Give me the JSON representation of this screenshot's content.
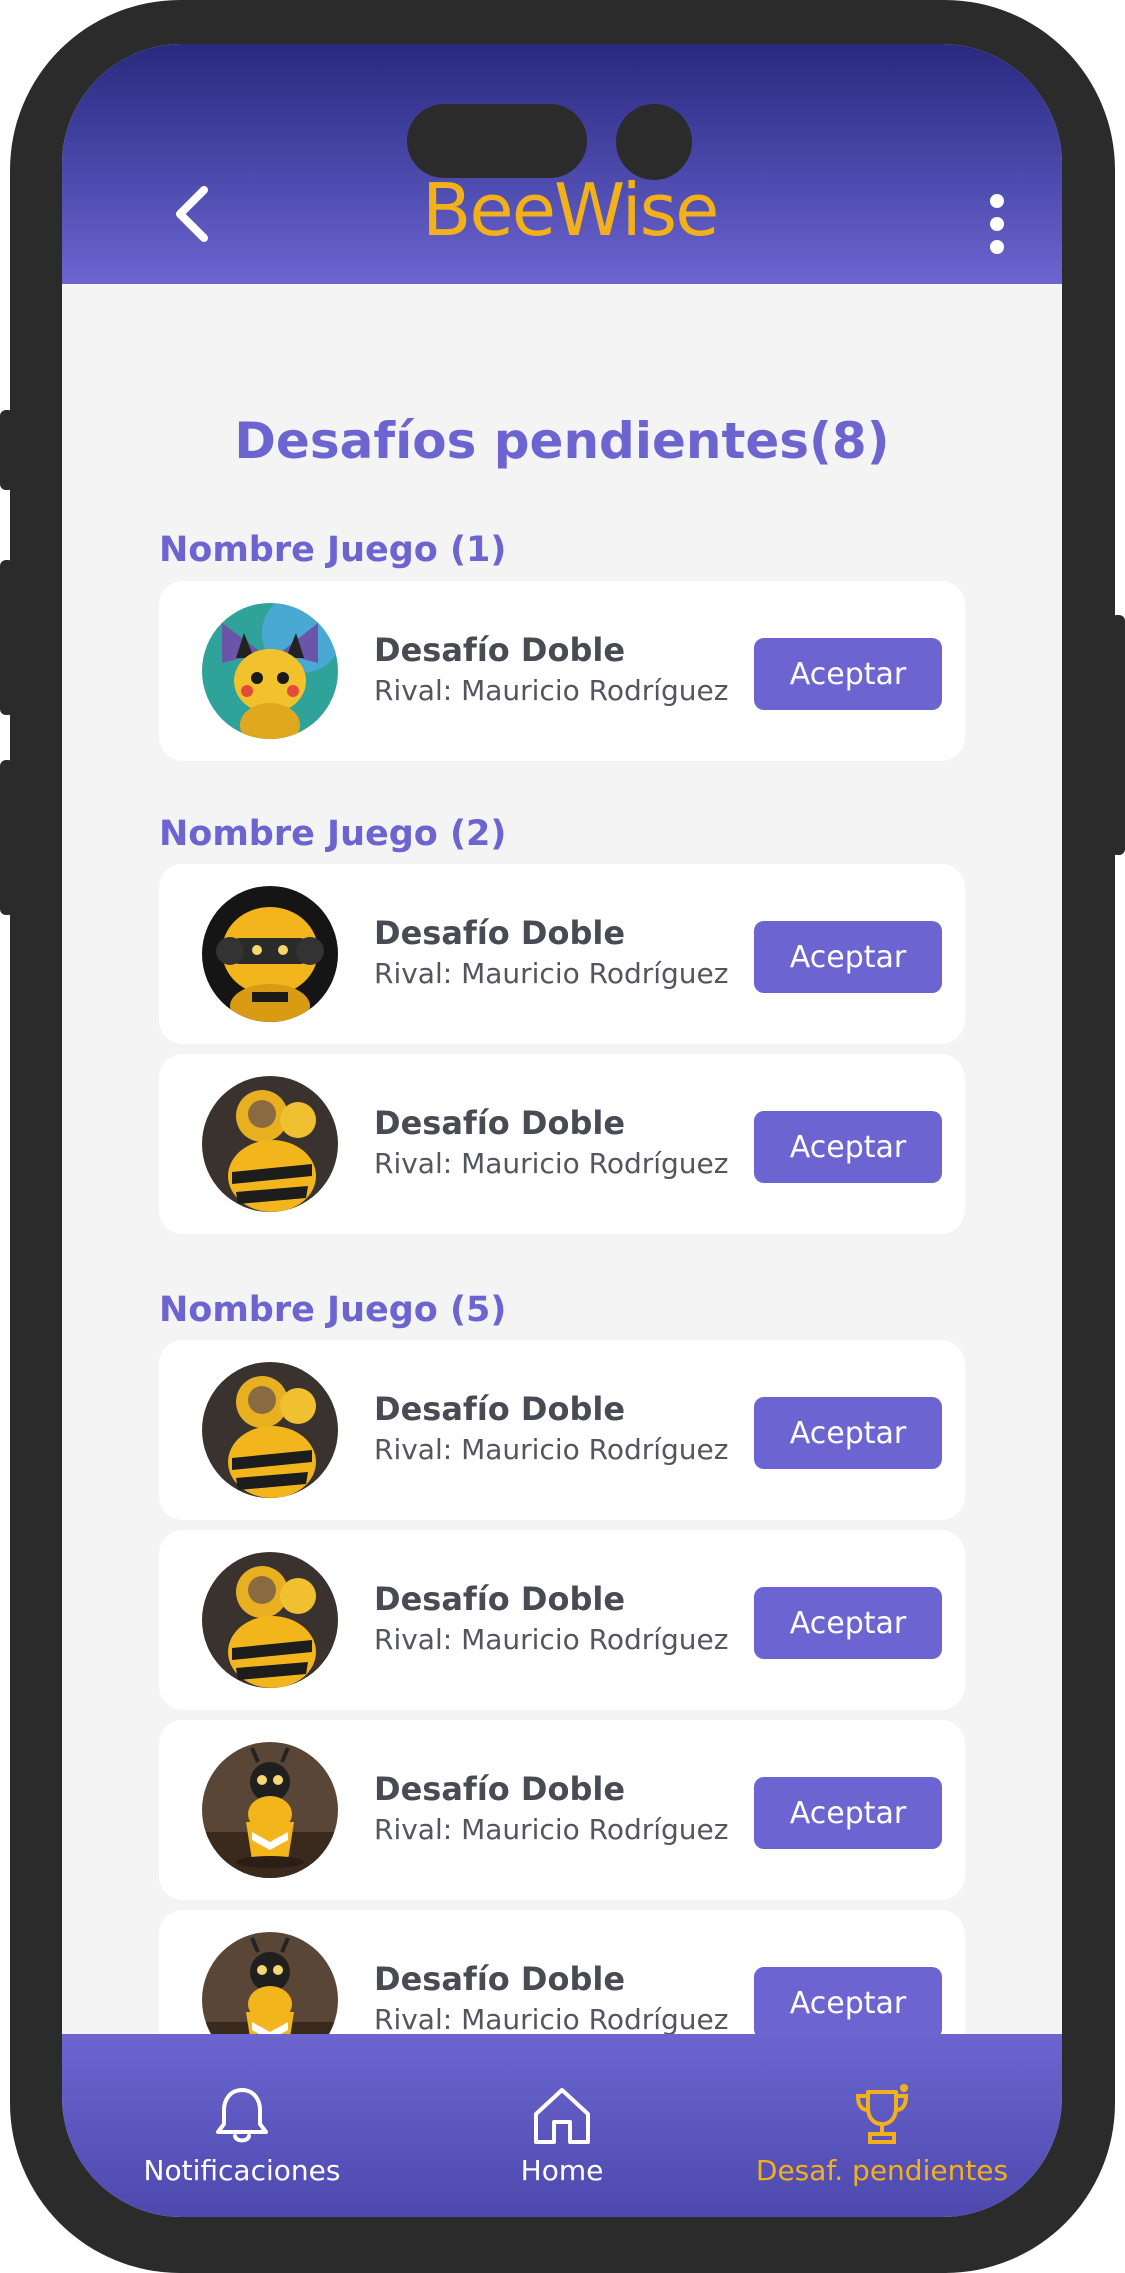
{
  "app": {
    "logo": "BeeWise"
  },
  "page": {
    "title": "Desafíos pendientes(8)"
  },
  "groups": [
    {
      "title": "Nombre Juego (1)"
    },
    {
      "title": "Nombre Juego (2)"
    },
    {
      "title": "Nombre Juego (5)"
    }
  ],
  "cards": [
    {
      "title": "Desafío Doble",
      "rival": "Rival: Mauricio Rodríguez",
      "button": "Aceptar",
      "avatar_icon": "pikachu-bee-avatar"
    },
    {
      "title": "Desafío Doble",
      "rival": "Rival: Mauricio Rodríguez",
      "button": "Aceptar",
      "avatar_icon": "robot-bee-avatar"
    },
    {
      "title": "Desafío Doble",
      "rival": "Rival: Mauricio Rodríguez",
      "button": "Aceptar",
      "avatar_icon": "armored-bee-avatar"
    },
    {
      "title": "Desafío Doble",
      "rival": "Rival: Mauricio Rodríguez",
      "button": "Aceptar",
      "avatar_icon": "armored-bee-avatar"
    },
    {
      "title": "Desafío Doble",
      "rival": "Rival: Mauricio Rodríguez",
      "button": "Aceptar",
      "avatar_icon": "armored-bee-avatar"
    },
    {
      "title": "Desafío Doble",
      "rival": "Rival: Mauricio Rodríguez",
      "button": "Aceptar",
      "avatar_icon": "cup-bee-avatar"
    },
    {
      "title": "Desafío Doble",
      "rival": "Rival: Mauricio Rodríguez",
      "button": "Aceptar",
      "avatar_icon": "cup-bee-avatar"
    }
  ],
  "nav": {
    "items": [
      {
        "label": "Notificaciones",
        "icon": "bell-icon"
      },
      {
        "label": "Home",
        "icon": "home-icon"
      },
      {
        "label": "Desaf. pendientes",
        "icon": "trophy-icon",
        "active": true
      }
    ]
  },
  "colors": {
    "primary": "#6b64d1",
    "header_dark": "#29297e",
    "accent": "#f3b119",
    "background": "#f4f4f5"
  }
}
